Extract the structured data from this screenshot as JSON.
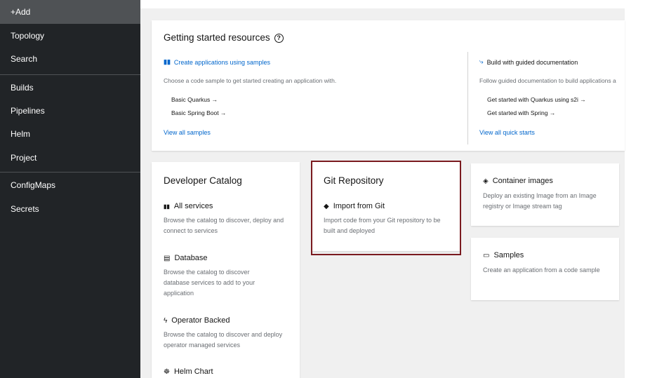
{
  "sidebar": {
    "items": [
      {
        "label": "+Add",
        "active": true
      },
      {
        "label": "Topology"
      },
      {
        "label": "Search"
      },
      {
        "label": "Builds"
      },
      {
        "label": "Pipelines"
      },
      {
        "label": "Helm"
      },
      {
        "label": "Project"
      },
      {
        "label": "ConfigMaps"
      },
      {
        "label": "Secrets"
      }
    ]
  },
  "getting_started": {
    "title": "Getting started resources",
    "help_icon": "question-circle-icon",
    "samples": {
      "icon": "book-icon",
      "title": "Create applications using samples",
      "description": "Choose a code sample to get started creating an application with.",
      "links": [
        "Basic Quarkus →",
        "Basic Spring Boot →"
      ],
      "view_all": "View all samples"
    },
    "guided": {
      "icon": "route-icon",
      "title": "Build with guided documentation",
      "description": "Follow guided documentation to build applications a",
      "links": [
        "Get started with Quarkus using s2i →",
        "Get started with Spring →"
      ],
      "view_all": "View all quick starts"
    }
  },
  "developer_catalog": {
    "title": "Developer Catalog",
    "items": [
      {
        "icon": "book-icon",
        "title": "All services",
        "description": "Browse the catalog to discover, deploy and connect to services"
      },
      {
        "icon": "database-icon",
        "title": "Database",
        "description": "Browse the catalog to discover database services to add to your application"
      },
      {
        "icon": "bolt-icon",
        "title": "Operator Backed",
        "description": "Browse the catalog to discover and deploy operator managed services"
      },
      {
        "icon": "helm-icon",
        "title": "Helm Chart"
      }
    ]
  },
  "git_repository": {
    "title": "Git Repository",
    "item": {
      "icon": "git-icon",
      "title": "Import from Git",
      "description": "Import code from your Git repository to be built and deployed"
    }
  },
  "container_images": {
    "icon": "layer-icon",
    "title": "Container images",
    "description": "Deploy an existing Image from an Image registry or Image stream tag"
  },
  "samples_card": {
    "icon": "laptop-icon",
    "title": "Samples",
    "description": "Create an application from a code sample"
  },
  "colors": {
    "sidebar_bg": "#212427",
    "active_bg": "#4f5255",
    "link": "#0066cc",
    "highlight_border": "#7a1a1f"
  }
}
